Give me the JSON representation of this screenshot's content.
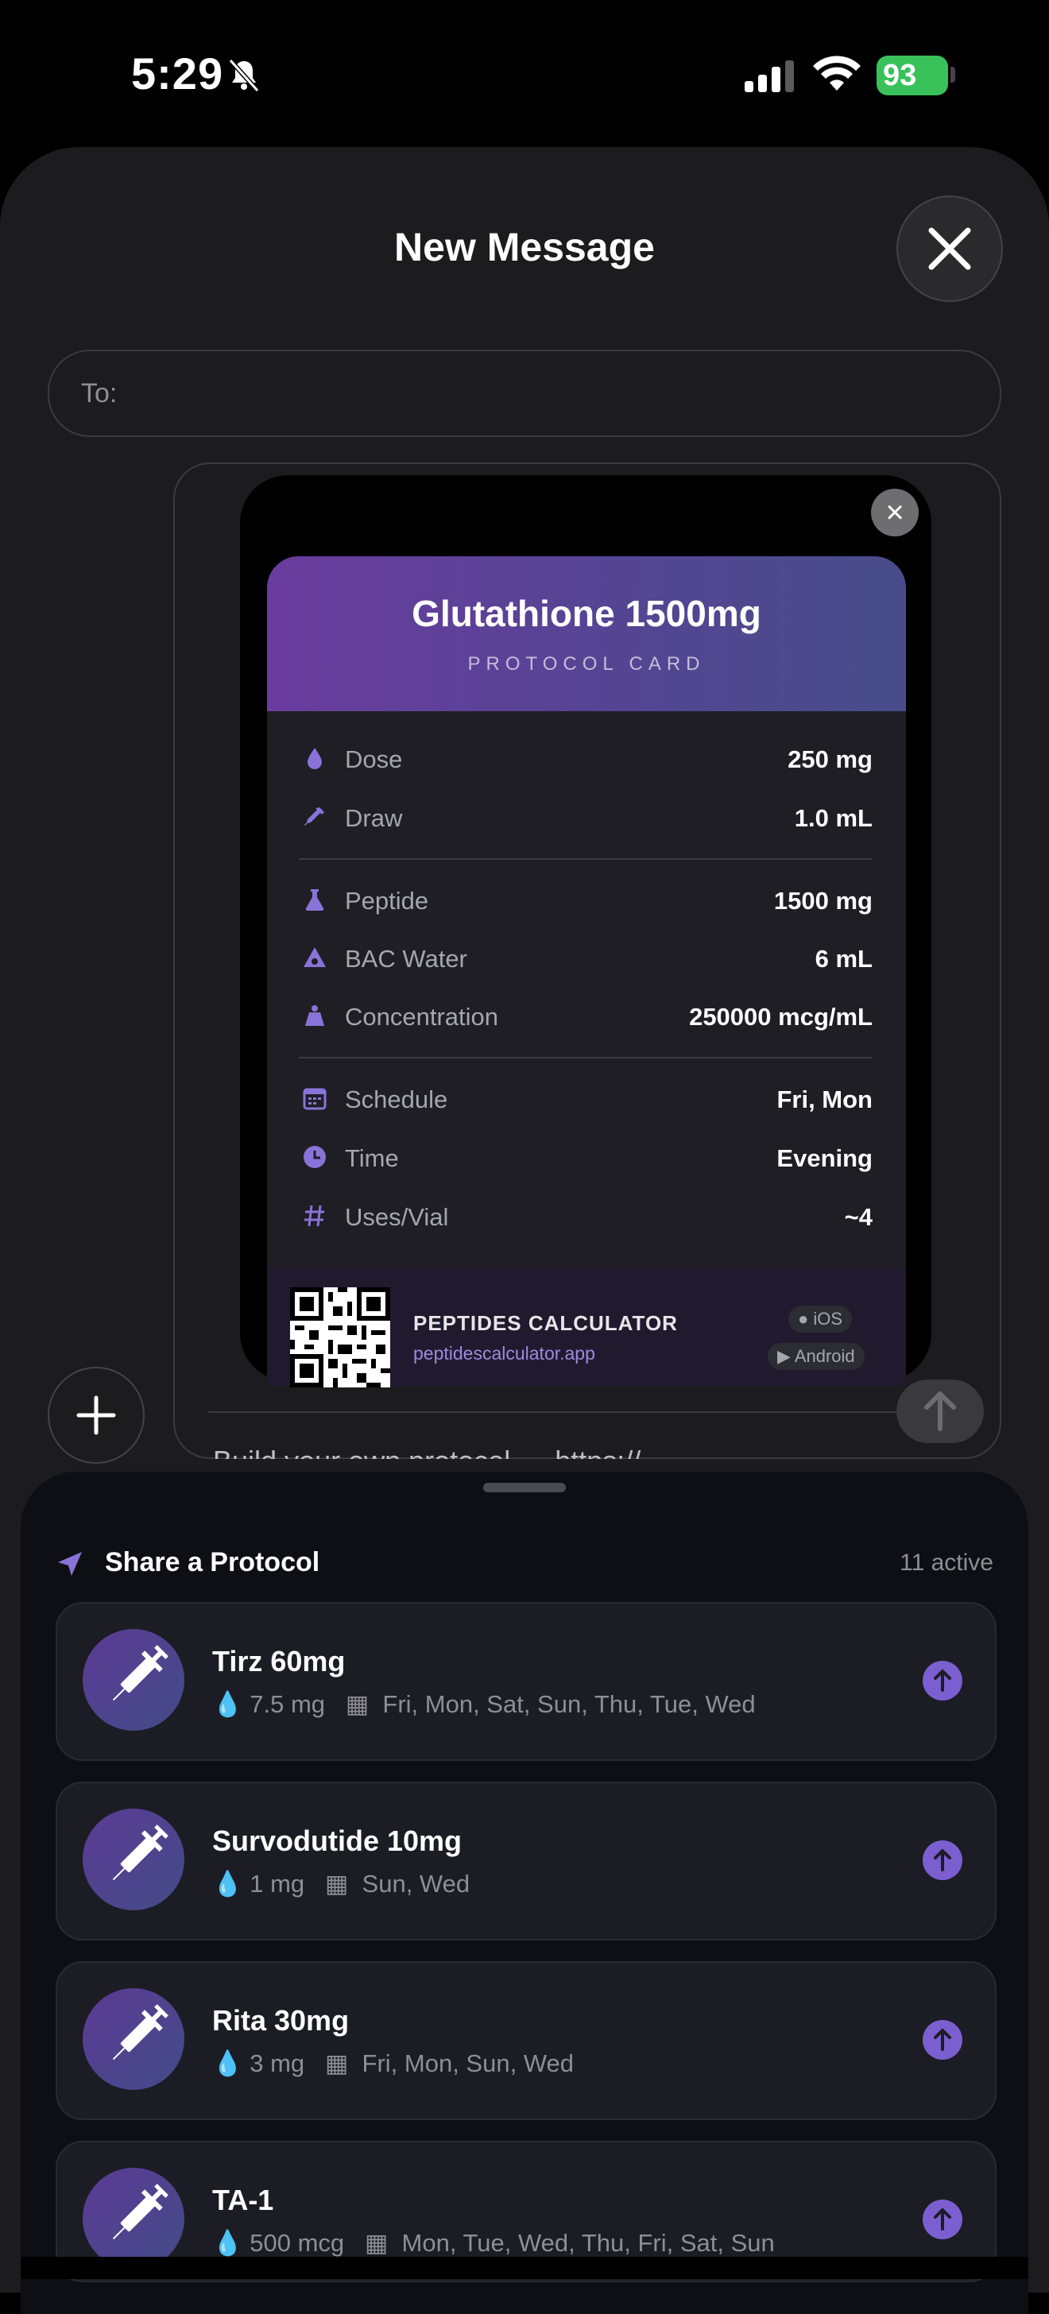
{
  "status_bar": {
    "time": "5:29",
    "battery": "93"
  },
  "sheet": {
    "title": "New Message",
    "to_label": "To:"
  },
  "card": {
    "title": "Glutathione 1500mg",
    "subtitle": "PROTOCOL CARD",
    "rows": [
      {
        "icon": "droplet-icon",
        "label": "Dose",
        "value": "250 mg"
      },
      {
        "icon": "syringe-draw-icon",
        "label": "Draw",
        "value": "1.0 mL"
      },
      {
        "icon": "flask-icon",
        "label": "Peptide",
        "value": "1500 mg"
      },
      {
        "icon": "water-icon",
        "label": "BAC Water",
        "value": "6 mL"
      },
      {
        "icon": "scale-icon",
        "label": "Concentration",
        "value": "250000 mcg/mL"
      },
      {
        "icon": "calendar-icon",
        "label": "Schedule",
        "value": "Fri, Mon"
      },
      {
        "icon": "clock-icon",
        "label": "Time",
        "value": "Evening"
      },
      {
        "icon": "hash-icon",
        "label": "Uses/Vial",
        "value": "~4"
      }
    ],
    "brand": "PEPTIDES CALCULATOR",
    "url": "peptidescalculator.app",
    "ios_badge": "iOS",
    "android_badge": "Android"
  },
  "compose_text": "Build your own protocol → https://...",
  "share": {
    "title": "Share a Protocol",
    "count": "11 active",
    "protocols": [
      {
        "name": "Tirz 60mg",
        "dose": "7.5 mg",
        "days": "Fri, Mon, Sat, Sun, Thu, Tue, Wed"
      },
      {
        "name": "Survodutide 10mg",
        "dose": "1 mg",
        "days": "Sun, Wed"
      },
      {
        "name": "Rita 30mg",
        "dose": "3 mg",
        "days": "Fri, Mon, Sun, Wed"
      },
      {
        "name": "TA-1",
        "dose": "500 mcg",
        "days": "Mon, Tue, Wed, Thu, Fri, Sat, Sun"
      }
    ]
  },
  "colors": {
    "accent": "#7b5fd1",
    "header_start": "#6a3c9e",
    "header_end": "#474d8a",
    "battery": "#39c15a"
  }
}
